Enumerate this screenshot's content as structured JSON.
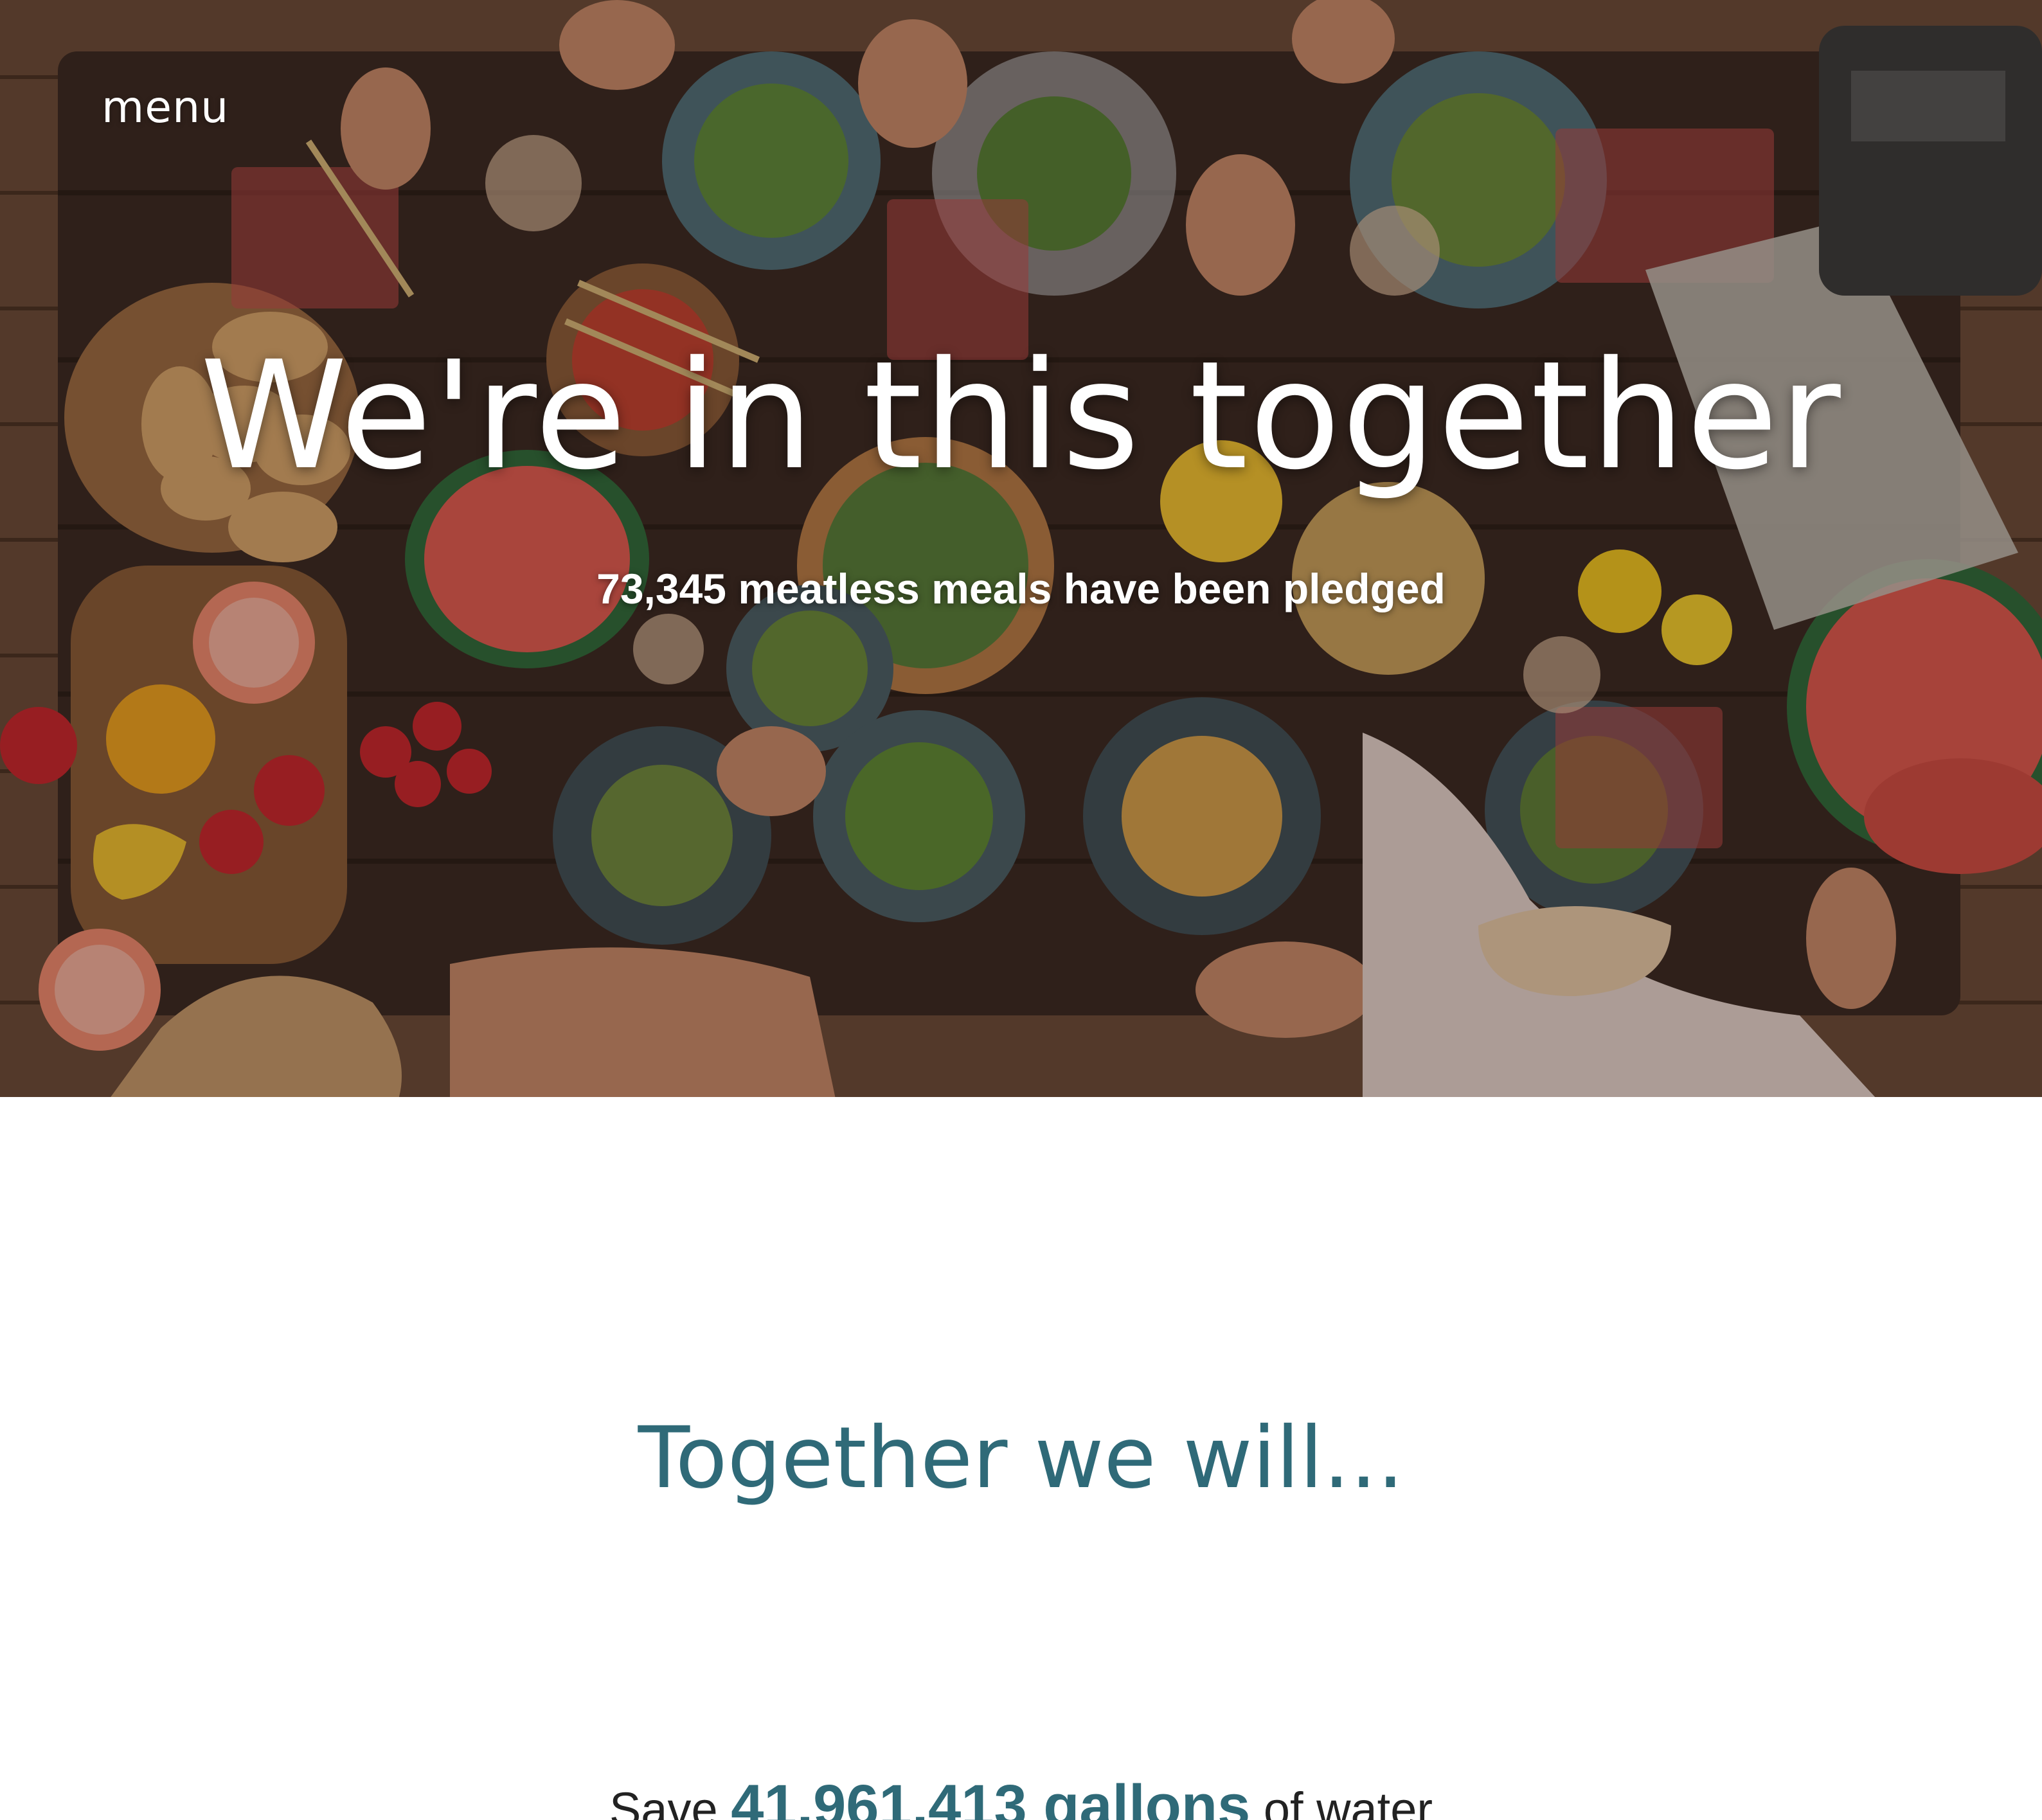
{
  "nav": {
    "menu_label": "menu"
  },
  "hero": {
    "title": "We're in this together",
    "counter_text": "73,345 meatless meals have been pledged"
  },
  "together": {
    "heading": "Together we will...",
    "impacts": [
      {
        "prefix": "Save",
        "highlight": "41,961,413 gallons",
        "suffix": "of water"
      }
    ]
  },
  "colors": {
    "accent_teal": "#2f6a78",
    "hero_text": "#ffffff",
    "body_text": "#222222"
  }
}
